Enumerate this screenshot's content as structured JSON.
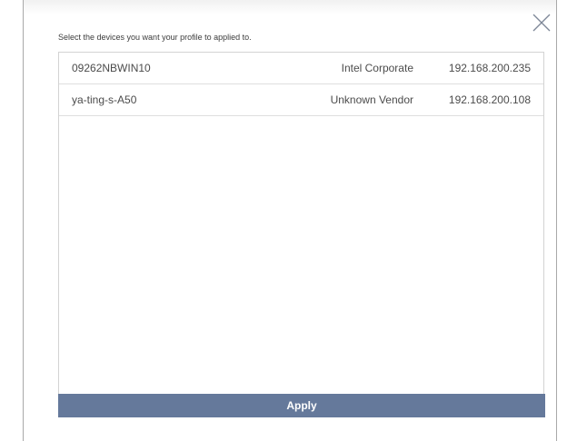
{
  "dialog": {
    "instruction": "Select the devices you want your profile to applied to.",
    "close_icon": "close-icon",
    "apply_label": "Apply"
  },
  "devices": [
    {
      "name": "09262NBWIN10",
      "vendor": "Intel Corporate",
      "ip": "192.168.200.235"
    },
    {
      "name": "ya-ting-s-A50",
      "vendor": "Unknown Vendor",
      "ip": "192.168.200.108"
    }
  ],
  "colors": {
    "apply_button_bg": "#65799b",
    "apply_button_text": "#ffffff",
    "close_icon": "#7d8797"
  }
}
